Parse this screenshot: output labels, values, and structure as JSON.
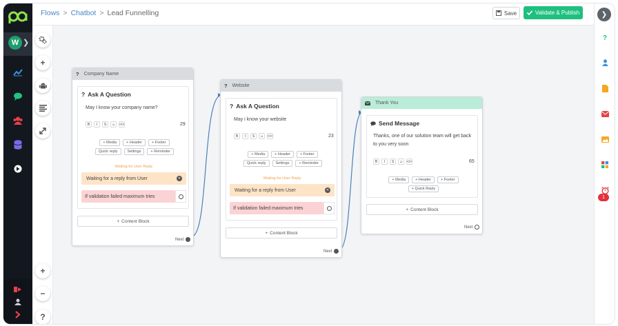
{
  "header": {
    "breadcrumbs": [
      "Flows",
      "Chatbot",
      "Lead Funnelling"
    ],
    "save_label": "Save",
    "publish_label": "Validate & Publish"
  },
  "sidebar": {
    "workspace_initial": "W"
  },
  "toolbar": {
    "zoom_in": "+",
    "zoom_out": "−",
    "help": "?",
    "add": "+"
  },
  "rail": {
    "help": "?",
    "badge_count": "1"
  },
  "nodes": {
    "company": {
      "header_label": "Company Name",
      "block_title": "Ask A Question",
      "message": "May I know your company name?",
      "char_count": "29",
      "chips": [
        "+ Media",
        "+ Header",
        "+ Footer",
        "Quick reply",
        "Settings",
        "+ Reminder"
      ],
      "waiting_label": "Waiting for User Reply",
      "waiting_box": "Waiting for a reply from User",
      "fail_box": "If validation failed maximum tries",
      "content_block": "Content Block",
      "next_label": "Next"
    },
    "website": {
      "header_label": "Website",
      "block_title": "Ask A Question",
      "message": "May i know your website",
      "char_count": "23",
      "chips": [
        "+ Media",
        "+ Header",
        "+ Footer",
        "Quick reply",
        "Settings",
        "+ Reminder"
      ],
      "waiting_label": "Waiting for User Reply",
      "waiting_box": "Waiting for a reply from User",
      "fail_box": "If validation failed maximum tries",
      "content_block": "Content Block",
      "next_label": "Next"
    },
    "thankyou": {
      "header_label": "Thank You",
      "block_title": "Send Message",
      "message_line1": "Thanks, one of our solution team will get back",
      "message_line2": "to you very soon",
      "char_count": "65",
      "chips": [
        "+ Media",
        "+ Header",
        "+ Footer",
        "+ Quick Reply"
      ],
      "content_block": "Content Block",
      "next_label": "Next"
    }
  },
  "format_buttons": [
    "B",
    "I",
    "S",
    "☺",
    "</>"
  ],
  "colors": {
    "sidebar_bg": "#13181f",
    "accent_green": "#1fc07f",
    "link_blue": "#4a86c5",
    "wait_orange": "#fde4c7",
    "fail_red": "#fbd3d4",
    "thankyou_header": "#b9ecd9"
  }
}
